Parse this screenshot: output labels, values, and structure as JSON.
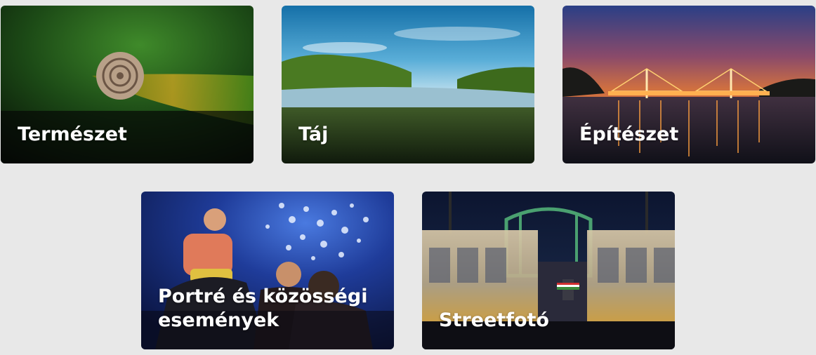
{
  "categories": [
    {
      "id": "termeszet",
      "label": "Természet",
      "icon": "snail-photo"
    },
    {
      "id": "taj",
      "label": "Táj",
      "icon": "river-landscape-photo"
    },
    {
      "id": "epiteszet",
      "label": "Építészet",
      "icon": "bridge-night-photo"
    },
    {
      "id": "portre",
      "label_lines": [
        "Portré és közösségi",
        "események"
      ],
      "icon": "fireworks-crowd-photo"
    },
    {
      "id": "streetfoto",
      "label": "Streetfotó",
      "icon": "tram-bridge-photo"
    }
  ],
  "colors": {
    "page_background": "#e8e8e8",
    "label_text": "#ffffff"
  }
}
